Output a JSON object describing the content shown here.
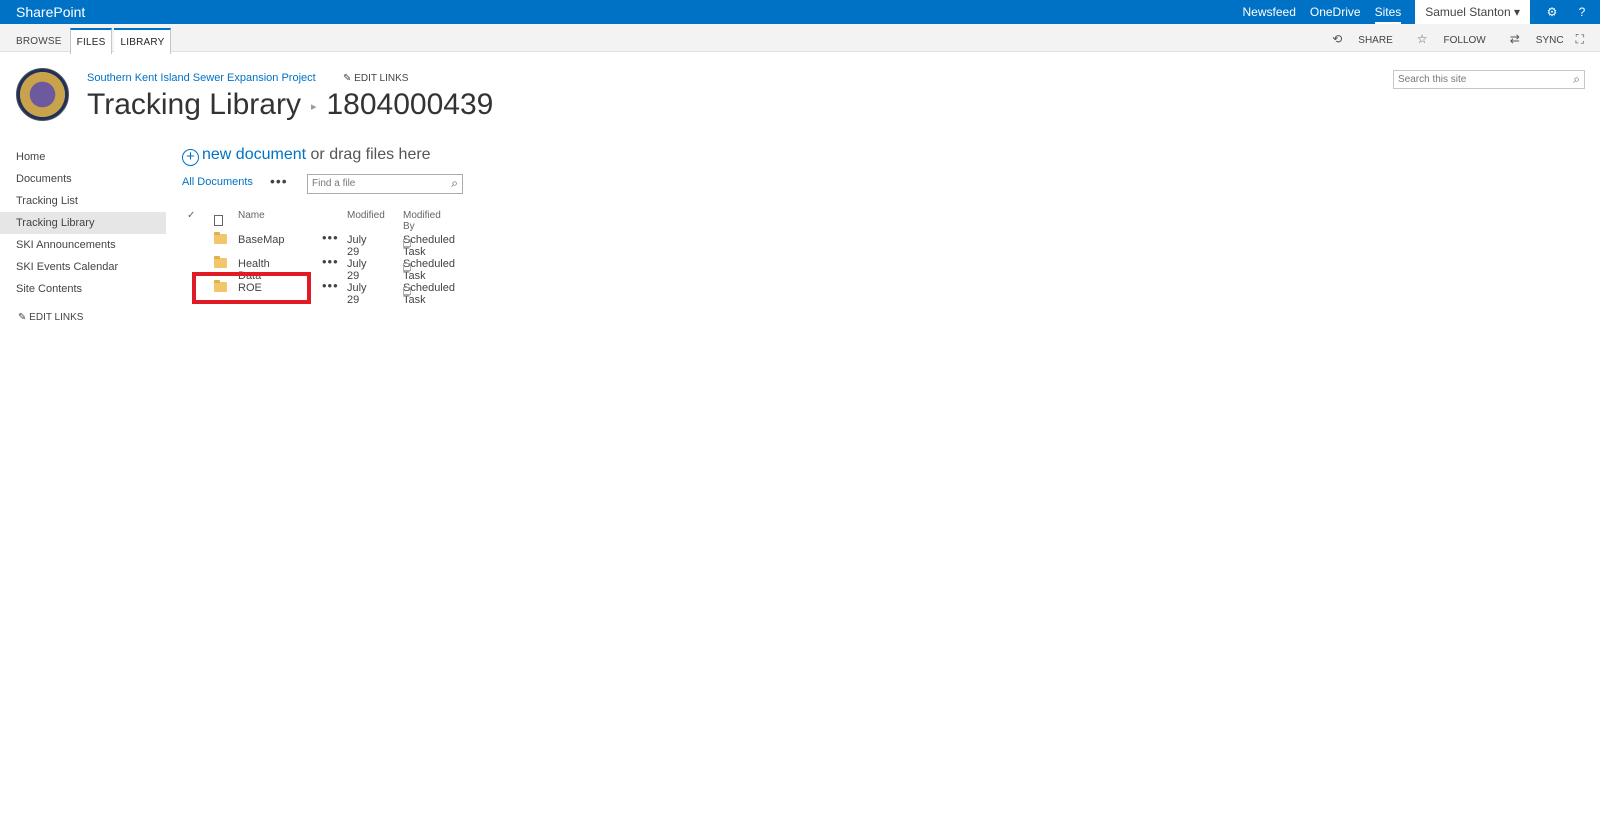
{
  "suitebar": {
    "brand": "SharePoint",
    "links": [
      "Newsfeed",
      "OneDrive",
      "Sites"
    ],
    "user": "Samuel Stanton",
    "help": "?"
  },
  "ribbon": {
    "tabs": [
      "BROWSE",
      "FILES",
      "LIBRARY"
    ],
    "share": "SHARE",
    "follow": "FOLLOW",
    "sync": "SYNC"
  },
  "header": {
    "site_link": "Southern Kent Island Sewer Expansion Project",
    "edit_links": "EDIT LINKS",
    "title": "Tracking Library",
    "subtitle": "1804000439",
    "search_placeholder": "Search this site"
  },
  "leftnav": {
    "items": [
      "Home",
      "Documents",
      "Tracking List",
      "Tracking Library",
      "SKI Announcements",
      "SKI Events Calendar",
      "Site Contents"
    ],
    "edit_links": "EDIT LINKS"
  },
  "main": {
    "new_document": "new document",
    "drag_text": "or drag files here",
    "view": "All Documents",
    "find_placeholder": "Find a file",
    "columns": {
      "name": "Name",
      "modified": "Modified",
      "modified_by": "Modified By"
    },
    "rows": [
      {
        "name": "BaseMap",
        "modified": "July 29",
        "modified_by": "Scheduled Task"
      },
      {
        "name": "Health Data",
        "modified": "July 29",
        "modified_by": "Scheduled Task"
      },
      {
        "name": "ROE",
        "modified": "July 29",
        "modified_by": "Scheduled Task"
      }
    ]
  },
  "colors": {
    "brand": "#0072c6",
    "highlight": "#e01b24"
  }
}
